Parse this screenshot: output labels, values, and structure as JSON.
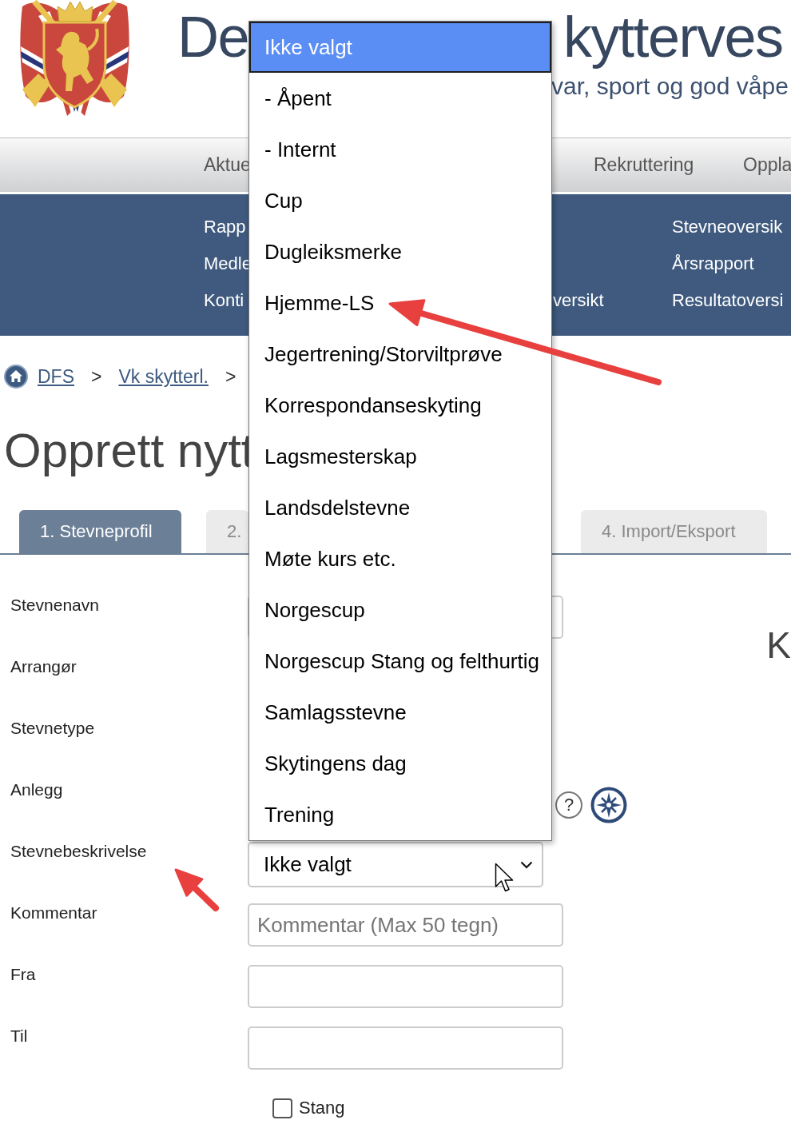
{
  "header": {
    "title_parts": [
      "De",
      "kytterves"
    ],
    "tagline": "var, sport og god våpe"
  },
  "main_nav": {
    "items": [
      "Aktue",
      "Rekruttering",
      "Oppla"
    ]
  },
  "sub_nav": {
    "rows": [
      {
        "column_1": "Rapp",
        "column_3": "Stevneoversik"
      },
      {
        "column_1": "Medle",
        "column_3": "Årsrapport"
      },
      {
        "column_1": "Konti",
        "column_2": "versikt",
        "column_3": "Resultatoversi"
      }
    ]
  },
  "breadcrumb": [
    {
      "kind": "home"
    },
    {
      "kind": "link",
      "label": "DFS"
    },
    {
      "kind": "separator",
      "label": ">"
    },
    {
      "kind": "link",
      "label": "Vk skytterl."
    },
    {
      "kind": "separator",
      "label": ">"
    }
  ],
  "page_title": "Opprett nytt",
  "tabs": [
    {
      "label": "1. Stevneprofil",
      "selected": true
    },
    {
      "label": "2.",
      "selected": false
    },
    {
      "label": "4. Import/Eksport",
      "selected": false
    }
  ],
  "form": {
    "rows": [
      {
        "label": "Stevnenavn",
        "kind": "input"
      },
      {
        "label": "Arrangør",
        "kind": "covered"
      },
      {
        "label": "Stevnetype",
        "kind": "covered"
      },
      {
        "label": "Anlegg",
        "kind": "icons",
        "help": "?"
      },
      {
        "label": "Stevnebeskrivelse",
        "kind": "select",
        "value": "Ikke valgt"
      },
      {
        "label": "Kommentar",
        "kind": "input",
        "placeholder": "Kommentar (Max 50 tegn)"
      },
      {
        "label": "Fra",
        "kind": "input"
      },
      {
        "label": "Til",
        "kind": "input"
      }
    ],
    "checkbox": {
      "label": "Stang",
      "checked": false
    }
  },
  "side_heading": "K",
  "dropdown": {
    "options": [
      {
        "label": "Ikke valgt",
        "selected": true
      },
      {
        "label": "- Åpent",
        "selected": false
      },
      {
        "label": "- Internt",
        "selected": false
      },
      {
        "label": "Cup",
        "selected": false
      },
      {
        "label": "Dugleiksmerke",
        "selected": false
      },
      {
        "label": "Hjemme-LS",
        "selected": false
      },
      {
        "label": "Jegertrening/Storviltprøve",
        "selected": false
      },
      {
        "label": "Korrespondanseskyting",
        "selected": false
      },
      {
        "label": "Lagsmesterskap",
        "selected": false
      },
      {
        "label": "Landsdelstevne",
        "selected": false
      },
      {
        "label": "Møte kurs etc.",
        "selected": false
      },
      {
        "label": "Norgescup",
        "selected": false
      },
      {
        "label": "Norgescup Stang og felthurtig",
        "selected": false
      },
      {
        "label": "Samlagsstevne",
        "selected": false
      },
      {
        "label": "Skytingens dag",
        "selected": false
      },
      {
        "label": "Trening",
        "selected": false
      }
    ]
  }
}
